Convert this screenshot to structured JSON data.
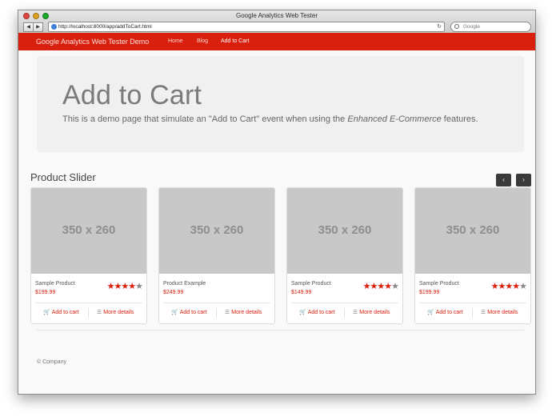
{
  "window": {
    "title": "Google Analytics Web Tester"
  },
  "browser": {
    "back_label": "◀",
    "forward_label": "▶",
    "url": "http://localhost:8000/app/addToCart.html",
    "reload_icon": "↻",
    "search_placeholder": "Google"
  },
  "navbar": {
    "brand": "Google Analytics Web Tester Demo",
    "links": [
      {
        "label": "Home",
        "active": false
      },
      {
        "label": "Blog",
        "active": false
      },
      {
        "label": "Add to Cart",
        "active": true
      }
    ],
    "color": "#d9200e"
  },
  "jumbotron": {
    "title": "Add to Cart",
    "text_before": "This is a demo page that simulate an \"Add to Cart\" event when using the ",
    "text_emphasis": "Enhanced E-Commerce",
    "text_after": " features."
  },
  "slider": {
    "title": "Product Slider",
    "prev_icon": "‹",
    "next_icon": "›",
    "products": [
      {
        "image_text": "350 x 260",
        "name": "Sample Product",
        "price": "$199.99",
        "rating": 4,
        "max_rating": 5,
        "add_label": "Add to cart",
        "details_label": "More details"
      },
      {
        "image_text": "350 x 260",
        "name": "Product Example",
        "price": "$249.99",
        "rating": 0,
        "max_rating": 0,
        "add_label": "Add to cart",
        "details_label": "More details"
      },
      {
        "image_text": "350 x 260",
        "name": "Sample Product",
        "price": "$149.99",
        "rating": 4,
        "max_rating": 5,
        "add_label": "Add to cart",
        "details_label": "More details"
      },
      {
        "image_text": "350 x 260",
        "name": "Sample Product",
        "price": "$199.99",
        "rating": 4,
        "max_rating": 5,
        "add_label": "Add to cart",
        "details_label": "More details"
      }
    ]
  },
  "footer": {
    "text": "© Company"
  },
  "icons": {
    "cart": "cart-icon",
    "list": "list-icon",
    "globe": "globe-icon",
    "search": "search-icon"
  }
}
